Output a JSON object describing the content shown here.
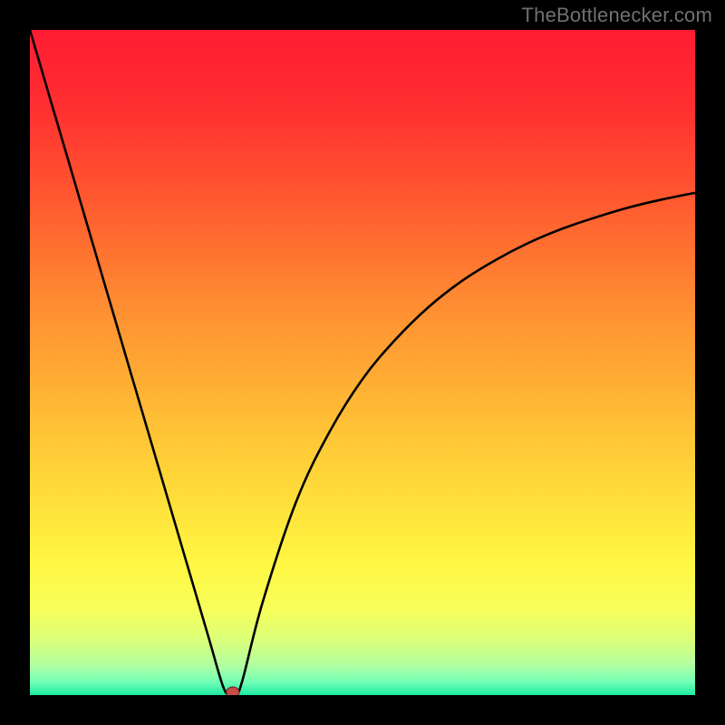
{
  "watermark": "TheBottlenecker.com",
  "chart_data": {
    "type": "line",
    "title": "",
    "xlabel": "",
    "ylabel": "",
    "xlim": [
      0,
      100
    ],
    "ylim": [
      0,
      100
    ],
    "series": [
      {
        "name": "bottleneck-curve",
        "x": [
          0,
          5,
          10,
          15,
          20,
          25,
          27,
          29,
          30,
          31,
          32,
          35,
          40,
          45,
          50,
          55,
          60,
          65,
          70,
          75,
          80,
          85,
          90,
          95,
          100
        ],
        "y": [
          100,
          83,
          66,
          49,
          32,
          15,
          8.2,
          1.4,
          0,
          0,
          2.4,
          14,
          29,
          39.5,
          47.5,
          53.5,
          58.4,
          62.3,
          65.4,
          68.0,
          70.1,
          71.8,
          73.3,
          74.5,
          75.5
        ]
      }
    ],
    "marker": {
      "x": 30.5,
      "y": 0
    },
    "gradient_stops": [
      {
        "offset": 0.0,
        "color": "#ff1c33"
      },
      {
        "offset": 0.12,
        "color": "#ff3030"
      },
      {
        "offset": 0.22,
        "color": "#ff4e2f"
      },
      {
        "offset": 0.32,
        "color": "#ff6e30"
      },
      {
        "offset": 0.42,
        "color": "#ff8f32"
      },
      {
        "offset": 0.52,
        "color": "#ffab34"
      },
      {
        "offset": 0.62,
        "color": "#ffc836"
      },
      {
        "offset": 0.72,
        "color": "#ffe23b"
      },
      {
        "offset": 0.8,
        "color": "#fff642"
      },
      {
        "offset": 0.87,
        "color": "#f8ff59"
      },
      {
        "offset": 0.92,
        "color": "#d9ff7c"
      },
      {
        "offset": 0.955,
        "color": "#b1ffa1"
      },
      {
        "offset": 0.98,
        "color": "#73ffb6"
      },
      {
        "offset": 1.0,
        "color": "#1de9a0"
      }
    ]
  }
}
